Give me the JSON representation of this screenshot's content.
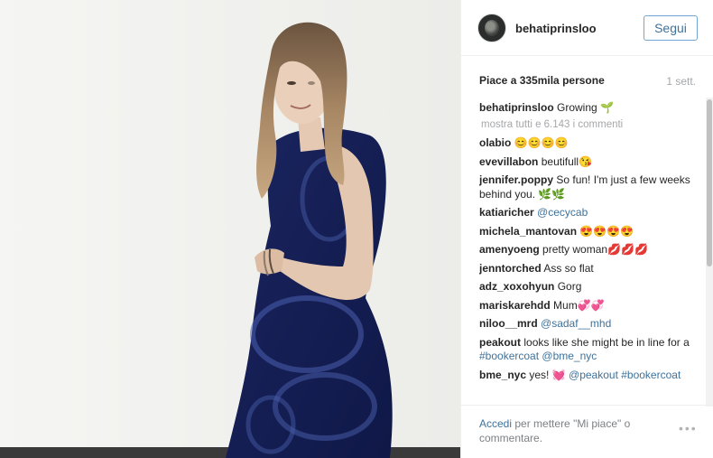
{
  "post": {
    "username": "behatiprinsloo",
    "follow_label": "Segui",
    "likes_text": "Piace a 335mila persone",
    "time_ago": "1 sett.",
    "caption_user": "behatiprinsloo",
    "caption_text": "Growing",
    "caption_emoji": "🌱",
    "show_all_comments": "mostra tutti e 6.143 i commenti"
  },
  "comments": [
    {
      "user": "olabio",
      "text": "😊😊😊😊"
    },
    {
      "user": "evevillabon",
      "text": "beutifull😘"
    },
    {
      "user": "jennifer.poppy",
      "text": "So fun! I'm just a few weeks behind you. 🌿🌿"
    },
    {
      "user": "katiaricher",
      "text": "",
      "mention": "@cecycab"
    },
    {
      "user": "michela_mantovan",
      "text": "😍😍😍😍"
    },
    {
      "user": "amenyoeng",
      "text": "pretty woman💋💋💋"
    },
    {
      "user": "jenntorched",
      "text": "Ass so flat"
    },
    {
      "user": "adz_xoxohyun",
      "text": "Gorg"
    },
    {
      "user": "mariskarehdd",
      "text": "Mum💞💞"
    },
    {
      "user": "niloo__mrd",
      "text": "",
      "mention": "@sadaf__mhd"
    },
    {
      "user": "peakout",
      "text": "looks like she might be in line for a",
      "mention": "#bookercoat @bme_nyc"
    },
    {
      "user": "bme_nyc",
      "text": "yes! 💓",
      "mention": "@peakout #bookercoat"
    }
  ],
  "footer": {
    "login_link": "Accedi",
    "login_rest": "per mettere \"Mi piace\" o commentare.",
    "more_options": "•••"
  },
  "icons": {
    "avatar": "profile-avatar",
    "more": "more-options-icon"
  },
  "colors": {
    "link": "#3f729b",
    "follow_border": "#6fa8d6",
    "muted": "#a5a7aa"
  }
}
